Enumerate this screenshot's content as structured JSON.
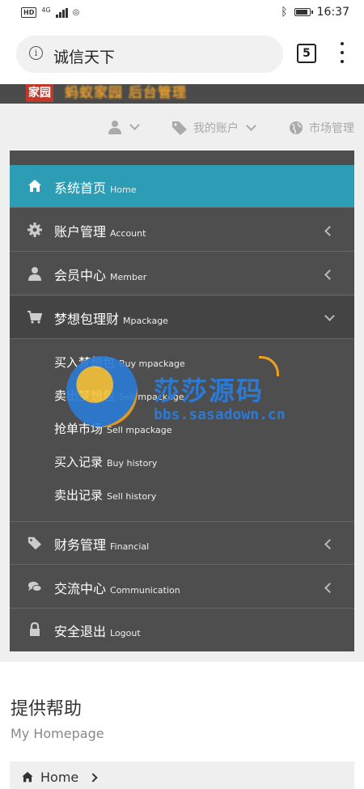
{
  "status_bar": {
    "hd": "HD",
    "net": "4G",
    "time": "16:37",
    "battery_level_pct": 90
  },
  "browser": {
    "url_text": "诚信天下",
    "tab_count": "5"
  },
  "site": {
    "logo_badge": "家园",
    "logo_text": "蚂蚁家园 后台管理"
  },
  "topnav": {
    "account": "我的账户",
    "market": "市场管理"
  },
  "menu": {
    "items": [
      {
        "zh": "系统首页",
        "en": "Home"
      },
      {
        "zh": "账户管理",
        "en": "Account"
      },
      {
        "zh": "会员中心",
        "en": "Member"
      },
      {
        "zh": "梦想包理财",
        "en": "Mpackage"
      },
      {
        "zh": "财务管理",
        "en": "Financial"
      },
      {
        "zh": "交流中心",
        "en": "Communication"
      },
      {
        "zh": "安全退出",
        "en": "Logout"
      }
    ],
    "submenu": [
      {
        "zh": "买入梦想包",
        "en": "Buy mpackage"
      },
      {
        "zh": "卖出梦想包",
        "en": "Sell mpackage"
      },
      {
        "zh": "抢单市场",
        "en": "Sell mpackage"
      },
      {
        "zh": "买入记录",
        "en": "Buy history"
      },
      {
        "zh": "卖出记录",
        "en": "Sell history"
      }
    ]
  },
  "watermark": {
    "title": "莎莎源码",
    "url": "bbs.sasadown.cn"
  },
  "page": {
    "heading": "提供帮助",
    "subheading": "My Homepage",
    "breadcrumb_home": "Home"
  },
  "colors": {
    "active": "#2c9db4",
    "sidebar": "#4e4e4e"
  }
}
